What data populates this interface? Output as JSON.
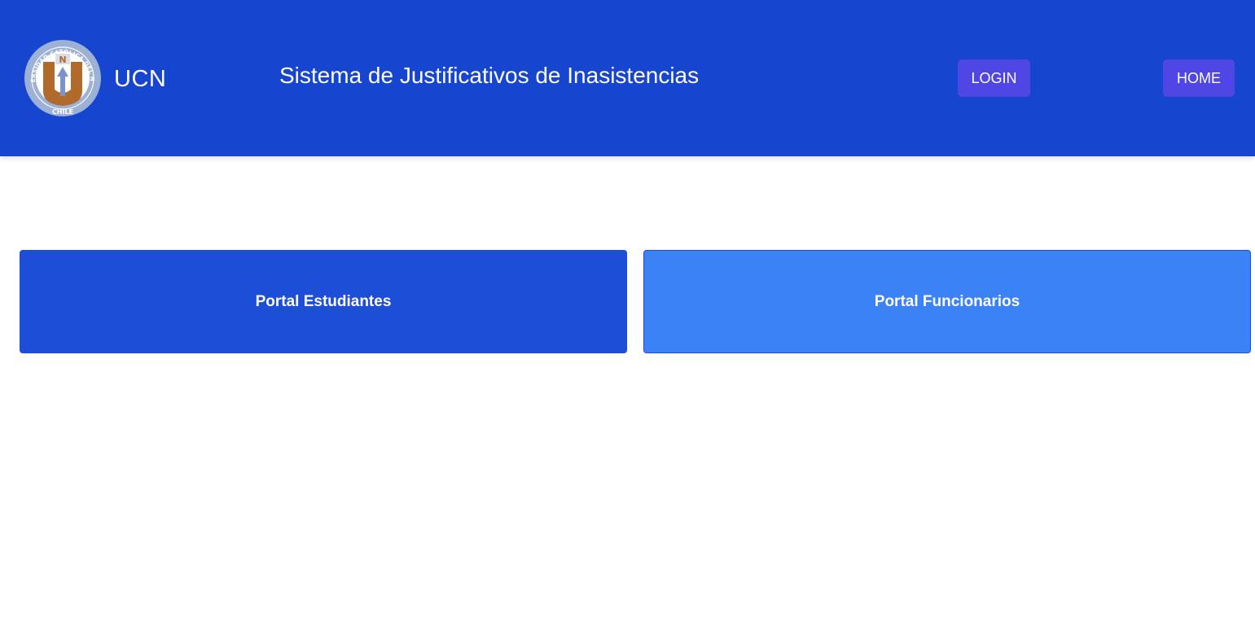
{
  "header": {
    "logo": {
      "ring_text": "UNIVERSIDAD CATÓLICA DEL NORTE",
      "bottom_text": "CHILE",
      "monogram": "U",
      "monogram_letter": "N"
    },
    "brand": "UCN",
    "title": "Sistema de Justificativos de Inasistencias",
    "login_label": "LOGIN",
    "home_label": "HOME"
  },
  "portals": [
    {
      "label": "Portal Estudiantes"
    },
    {
      "label": "Portal Funcionarios"
    }
  ],
  "colors": {
    "header_bg": "#1645cf",
    "nav_button_bg": "#4f46e5",
    "portal_students_bg": "#1d4ed8",
    "portal_staff_bg": "#3b82f6",
    "logo_ring": "#9db0d6",
    "logo_shield": "#b06a2c"
  }
}
